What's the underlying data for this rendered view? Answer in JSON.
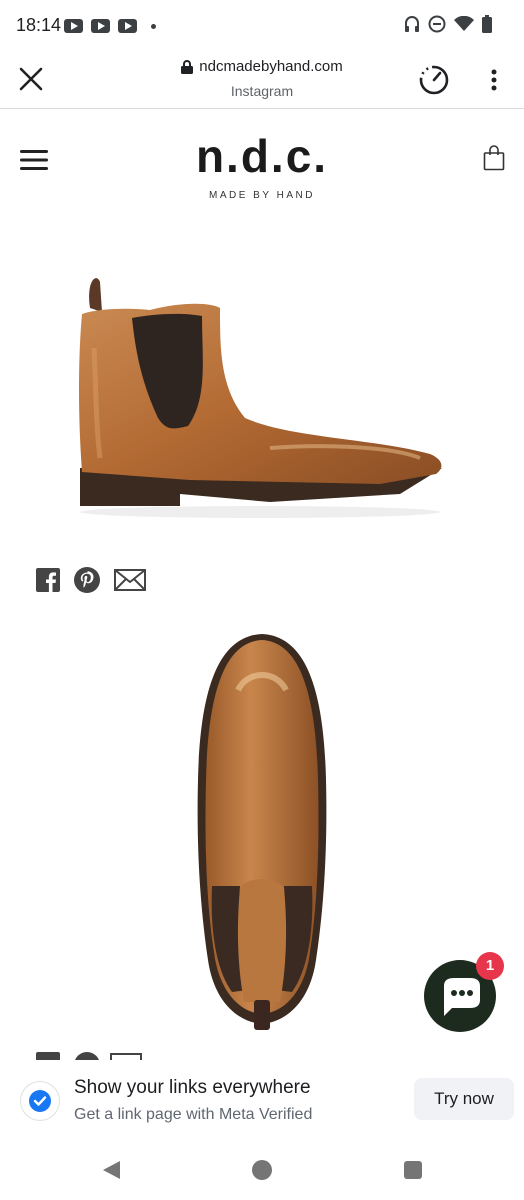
{
  "status_bar": {
    "time": "18:14"
  },
  "browser": {
    "url": "ndcmadebyhand.com",
    "source": "Instagram"
  },
  "site": {
    "logo": "n.d.c.",
    "tagline": "MADE BY HAND"
  },
  "chat": {
    "badge_count": "1"
  },
  "promo": {
    "title": "Show your links everywhere",
    "subtitle": "Get a link page with Meta Verified",
    "button": "Try now"
  },
  "colors": {
    "accent_badge": "#e7354b",
    "chat_bg": "#1d2b1f",
    "verified_blue": "#1877f2"
  },
  "icons": [
    "youtube-icon",
    "headphones-icon",
    "dnd-icon",
    "wifi-icon",
    "battery-icon",
    "close-icon",
    "lock-icon",
    "speed-icon",
    "more-icon",
    "menu-icon",
    "bag-icon",
    "facebook-icon",
    "pinterest-icon",
    "mail-icon",
    "chat-icon",
    "verified-icon",
    "back-icon",
    "home-icon",
    "recents-icon"
  ]
}
